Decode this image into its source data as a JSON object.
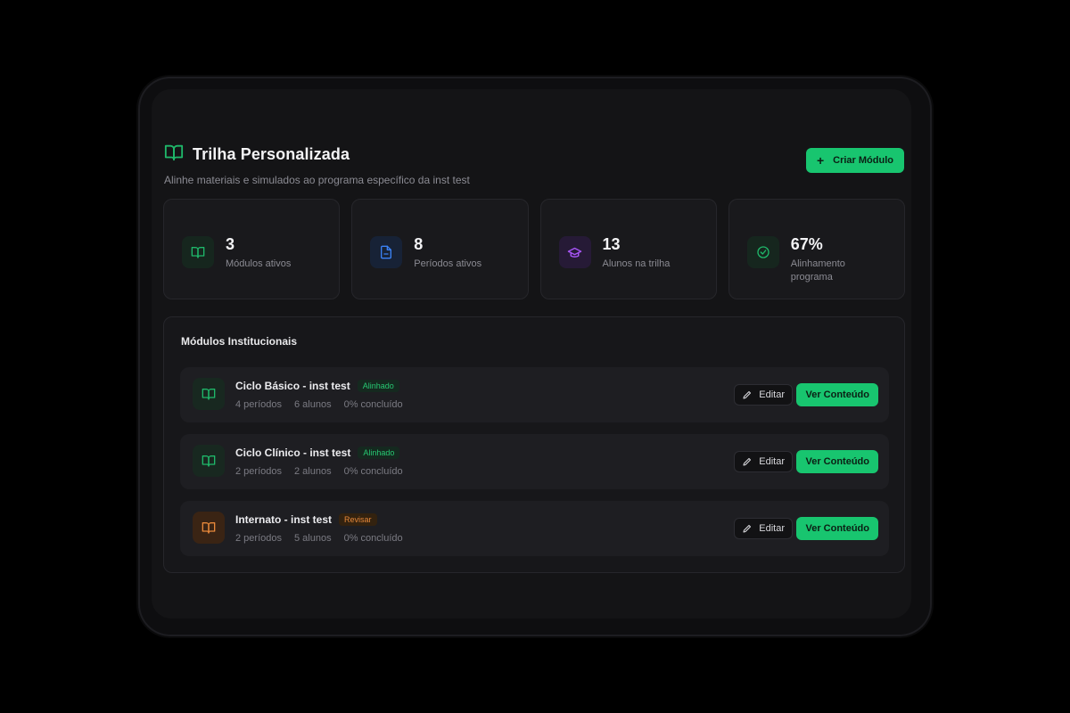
{
  "header": {
    "title": "Trilha Personalizada",
    "subtitle": "Alinhe materiais e simulados ao programa específico da inst test",
    "create_button": "Criar Módulo",
    "icon": "book-open-icon"
  },
  "stats": [
    {
      "value": "3",
      "label": "Módulos ativos",
      "icon": "book-open-icon",
      "color": "#1fb86a"
    },
    {
      "value": "8",
      "label": "Períodos ativos",
      "icon": "document-icon",
      "color": "#3b82f6"
    },
    {
      "value": "13",
      "label": "Alunos na trilha",
      "icon": "graduation-cap-icon",
      "color": "#a855f7"
    },
    {
      "value": "67%",
      "label": "Alinhamento programa",
      "icon": "check-circle-icon",
      "color": "#1fb86a"
    }
  ],
  "modules_panel": {
    "title": "Módulos Institucionais",
    "modules": [
      {
        "name": "Ciclo Básico - inst test",
        "badge": "Alinhado",
        "periods": "4 períodos",
        "students": "6 alunos",
        "progress": "0% concluído",
        "status": "ok"
      },
      {
        "name": "Ciclo Clínico - inst test",
        "badge": "Alinhado",
        "periods": "2 períodos",
        "students": "2 alunos",
        "progress": "0% concluído",
        "status": "ok"
      },
      {
        "name": "Internato - inst test",
        "badge": "Revisar",
        "periods": "2 períodos",
        "students": "5 alunos",
        "progress": "0% concluído",
        "status": "warn"
      }
    ],
    "edit_label": "Editar",
    "view_label": "Ver Conteúdo"
  },
  "colors": {
    "accent": "#18c56f",
    "background": "#141416",
    "card": "#19191c",
    "warning": "#e7883a"
  }
}
